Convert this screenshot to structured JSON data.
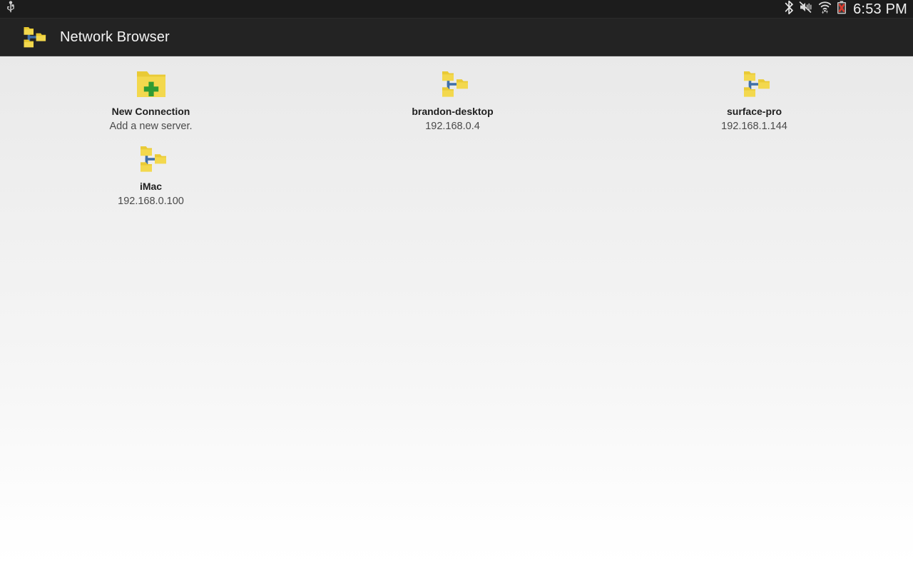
{
  "status_bar": {
    "left_icons": [
      {
        "name": "usb-icon",
        "label": "USB connected"
      }
    ],
    "right_icons": [
      {
        "name": "bluetooth-icon",
        "label": "Bluetooth"
      },
      {
        "name": "volume-mute-vibrate-icon",
        "label": "Silent / vibrate"
      },
      {
        "name": "wifi-icon",
        "label": "Wi-Fi connected"
      },
      {
        "name": "battery-unknown-icon",
        "label": "Battery unknown"
      }
    ],
    "clock": "6:53 PM"
  },
  "action_bar": {
    "app_icon": "network-folders-icon",
    "title": "Network Browser"
  },
  "colors": {
    "status_bar_bg": "#1c1c1c",
    "action_bar_bg": "#232323",
    "content_bg_top": "#e9e9e9",
    "content_bg_bottom": "#ffffff",
    "folder_yellow": "#f3d84d",
    "folder_yellow_dark": "#e7c72f",
    "connector_blue": "#3f6fa8",
    "plus_green": "#2f9b33",
    "title_text": "#1f1f1f",
    "subtitle_text": "#4a4a4a"
  },
  "main": {
    "items": [
      {
        "name": "new-connection",
        "icon": "folder-plus-icon",
        "title": "New Connection",
        "subtitle": "Add a new server."
      },
      {
        "name": "server-brandon-desktop",
        "icon": "network-folders-icon",
        "title": "brandon-desktop",
        "subtitle": "192.168.0.4"
      },
      {
        "name": "server-surface-pro",
        "icon": "network-folders-icon",
        "title": "surface-pro",
        "subtitle": "192.168.1.144"
      },
      {
        "name": "server-imac",
        "icon": "network-folders-icon",
        "title": "iMac",
        "subtitle": "192.168.0.100"
      }
    ]
  }
}
